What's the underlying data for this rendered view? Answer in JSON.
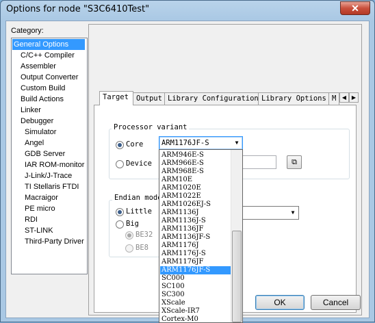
{
  "window": {
    "title": "Options for node \"S3C6410Test\"",
    "close_glyph": "✕"
  },
  "category": {
    "label": "Category:",
    "items": [
      "General Options",
      "C/C++ Compiler",
      "Assembler",
      "Output Converter",
      "Custom Build",
      "Build Actions",
      "Linker",
      "Debugger",
      "Simulator",
      "Angel",
      "GDB Server",
      "IAR ROM-monitor",
      "J-Link/J-Trace",
      "TI Stellaris FTDI",
      "Macraigor",
      "PE micro",
      "RDI",
      "ST-LINK",
      "Third-Party Driver"
    ],
    "selected": "General Options"
  },
  "tabs": [
    "Target",
    "Output",
    "Library Configuration",
    "Library Options",
    "M"
  ],
  "tab_scroll": {
    "left": "◀",
    "right": "▶"
  },
  "processor_variant": {
    "label": "Processor variant",
    "core_label": "Core",
    "core_value": "ARM1176JF-S",
    "device_label": "Device",
    "device_browse_glyph": "⧉"
  },
  "endian": {
    "label": "Endian mode",
    "little_label": "Little",
    "big_label": "Big",
    "be32_label": "BE32",
    "be8_label": "BE8"
  },
  "dropdown": {
    "items": [
      "ARM946E-S",
      "ARM966E-S",
      "ARM968E-S",
      "ARM10E",
      "ARM1020E",
      "ARM1022E",
      "ARM1026EJ-S",
      "ARM1136J",
      "ARM1136J-S",
      "ARM1136JF",
      "ARM1136JF-S",
      "ARM1176J",
      "ARM1176J-S",
      "ARM1176JF",
      "ARM1176JF-S",
      "SC000",
      "SC100",
      "SC300",
      "XScale",
      "XScale-IR7",
      "Cortex-M0"
    ],
    "selected": "ARM1176JF-S"
  },
  "buttons": {
    "ok": "OK",
    "cancel": "Cancel"
  },
  "colors": {
    "selection": "#3399ff",
    "titlebar": "#a9c8e4",
    "close": "#c9503c"
  }
}
